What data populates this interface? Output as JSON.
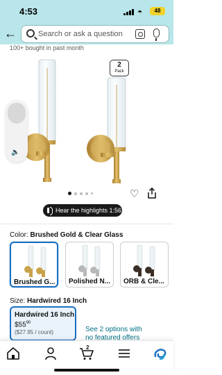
{
  "status": {
    "time": "4:53",
    "battery": "48"
  },
  "search": {
    "placeholder": "Search or ask a question"
  },
  "bought_text": "100+ bought in past month",
  "pack": {
    "count": "2",
    "label": "Pack"
  },
  "gallery": {
    "dot_count": 5,
    "active_dot": 1
  },
  "hear_highlights": "Hear the highlights 1:56",
  "color": {
    "label": "Color:",
    "value": "Brushed Gold & Clear Glass",
    "options": [
      {
        "label": "Brushed G...",
        "selected": true,
        "metal": "#c9a24a"
      },
      {
        "label": "Polished N...",
        "selected": false,
        "metal": "#b8b8b8"
      },
      {
        "label": "ORB & Cle...",
        "selected": false,
        "metal": "#3a2e26"
      }
    ]
  },
  "size": {
    "label": "Size:",
    "value": "Hardwired 16 Inch",
    "card": {
      "title": "Hardwired 16 Inch",
      "price_dollars": "$55",
      "price_cents": "90",
      "unit_price": "($27.95 / count)"
    },
    "see_options": "See 2 options with no featured offers"
  },
  "nav": {
    "cart_count": "2"
  },
  "colors": {
    "header_bg": "#b8e6ea",
    "accent_blue": "#1b6ec2",
    "link": "#007185"
  }
}
